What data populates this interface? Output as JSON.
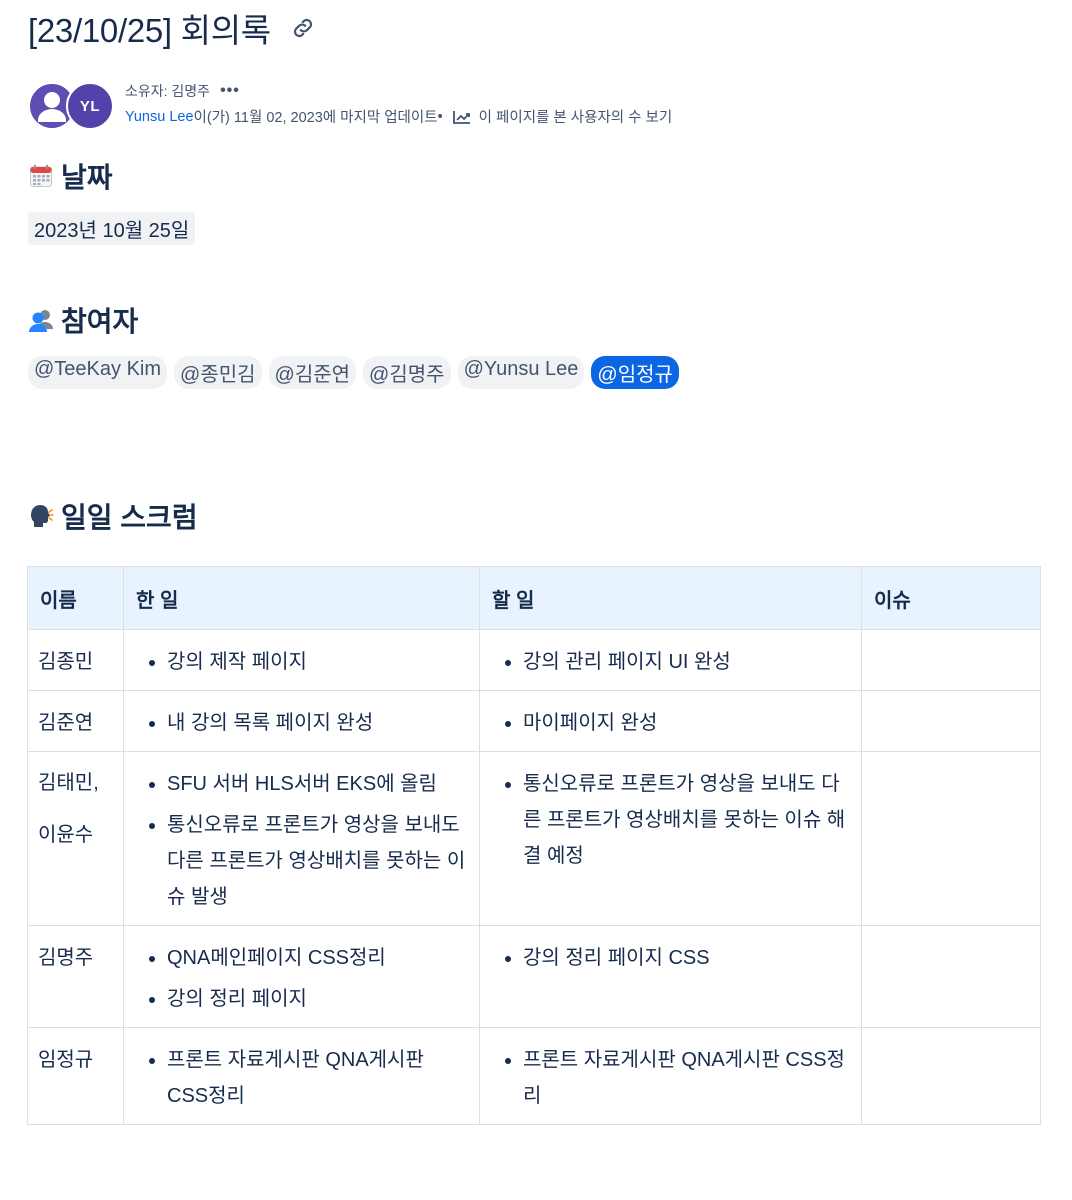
{
  "page": {
    "title": "[23/10/25] 회의록"
  },
  "byline": {
    "owner": "소유자: 김명주",
    "more_label": "•••",
    "avatar_initials": "YL",
    "author": "Yunsu Lee",
    "updated_text": "이(가) 11월 02, 2023에 마지막 업데이트",
    "separator": "•",
    "analytics_label": "이 페이지를 본 사용자의 수 보기"
  },
  "sections": {
    "date_heading": "날짜",
    "date_value": "2023년 10월 25일",
    "participants_heading": "참여자",
    "participants": [
      "@TeeKay Kim",
      "@종민김",
      "@김준연",
      "@김명주",
      "@Yunsu Lee",
      "@임정규"
    ],
    "scrum_heading": "일일 스크럼"
  },
  "table": {
    "headers": [
      "이름",
      "한 일",
      "할 일",
      "이슈"
    ],
    "rows": [
      {
        "name": "김종민",
        "done": [
          "강의 제작 페이지"
        ],
        "todo": [
          "강의 관리 페이지 UI 완성"
        ],
        "issue": ""
      },
      {
        "name": "김준연",
        "done": [
          "내 강의 목록 페이지 완성"
        ],
        "todo": [
          "마이페이지 완성"
        ],
        "issue": ""
      },
      {
        "name": "김태민, 이윤수",
        "done": [
          "SFU 서버 HLS서버 EKS에 올림",
          "통신오류로 프론트가 영상을 보내도 다른 프론트가 영상배치를 못하는 이슈 발생"
        ],
        "todo": [
          "통신오류로 프론트가 영상을 보내도 다른 프론트가 영상배치를 못하는 이슈 해결 예정"
        ],
        "issue": ""
      },
      {
        "name": "김명주",
        "done": [
          "QNA메인페이지 CSS정리",
          "강의 정리 페이지"
        ],
        "todo": [
          "강의 정리 페이지 CSS"
        ],
        "issue": ""
      },
      {
        "name": "임정규",
        "done": [
          "프론트 자료게시판 QNA게시판 CSS정리"
        ],
        "todo": [
          "프론트 자료게시판 QNA게시판 CSS정리"
        ],
        "issue": ""
      }
    ]
  },
  "colors": {
    "text": "#172b4d",
    "link": "#0c66e4",
    "header_bg": "#e9f2ff",
    "mention_bg": "#f1f2f4",
    "mention_self_bg": "#0c66e4",
    "avatar_bg": "#5e4db2"
  },
  "icons": {
    "title_link": "link-icon",
    "more": "more-icon",
    "analytics": "chart-line-icon",
    "date_emoji": "calendar-icon",
    "participants_emoji": "people-icon",
    "scrum_emoji": "speaking-head-icon"
  }
}
